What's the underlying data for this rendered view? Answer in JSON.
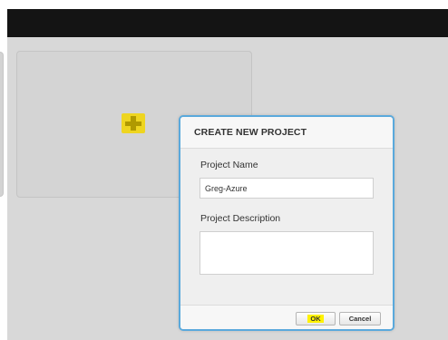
{
  "background": {
    "add_project_icon": "plus-icon"
  },
  "dialog": {
    "title": "CREATE NEW PROJECT",
    "project_name_label": "Project Name",
    "project_name_value": "Greg-Azure",
    "project_description_label": "Project Description",
    "project_description_value": "",
    "ok_label": "OK",
    "cancel_label": "Cancel"
  },
  "colors": {
    "top_bar": "#141414",
    "overlay": "#d8d8d8",
    "dialog_border": "#5aa9dc",
    "highlight": "#fff200"
  }
}
